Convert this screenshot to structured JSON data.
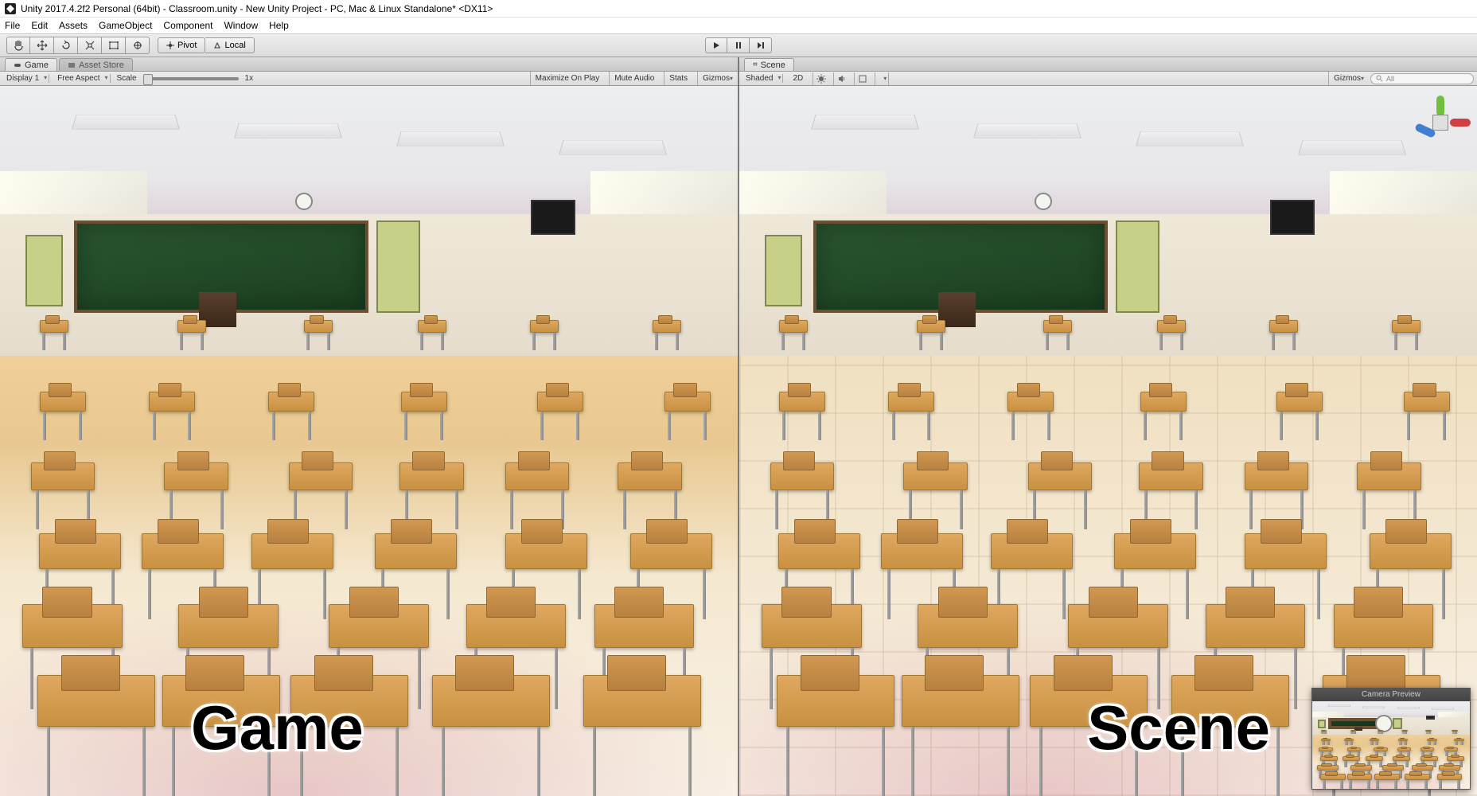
{
  "window": {
    "title": "Unity 2017.4.2f2 Personal (64bit) - Classroom.unity - New Unity Project - PC, Mac & Linux Standalone* <DX11>"
  },
  "menu": {
    "items": [
      "File",
      "Edit",
      "Assets",
      "GameObject",
      "Component",
      "Window",
      "Help"
    ]
  },
  "toolbar": {
    "pivot_label": "Pivot",
    "local_label": "Local"
  },
  "game": {
    "tab_game": "Game",
    "tab_asset_store": "Asset Store",
    "display": "Display 1",
    "aspect": "Free Aspect",
    "scale_label": "Scale",
    "scale_value": "1x",
    "maximize": "Maximize On Play",
    "mute": "Mute Audio",
    "stats": "Stats",
    "gizmos": "Gizmos",
    "overlay": "Game"
  },
  "scene": {
    "tab_scene": "Scene",
    "shaded": "Shaded",
    "twod": "2D",
    "gizmos": "Gizmos",
    "search_placeholder": "All",
    "overlay": "Scene",
    "camera_preview": "Camera Preview"
  }
}
